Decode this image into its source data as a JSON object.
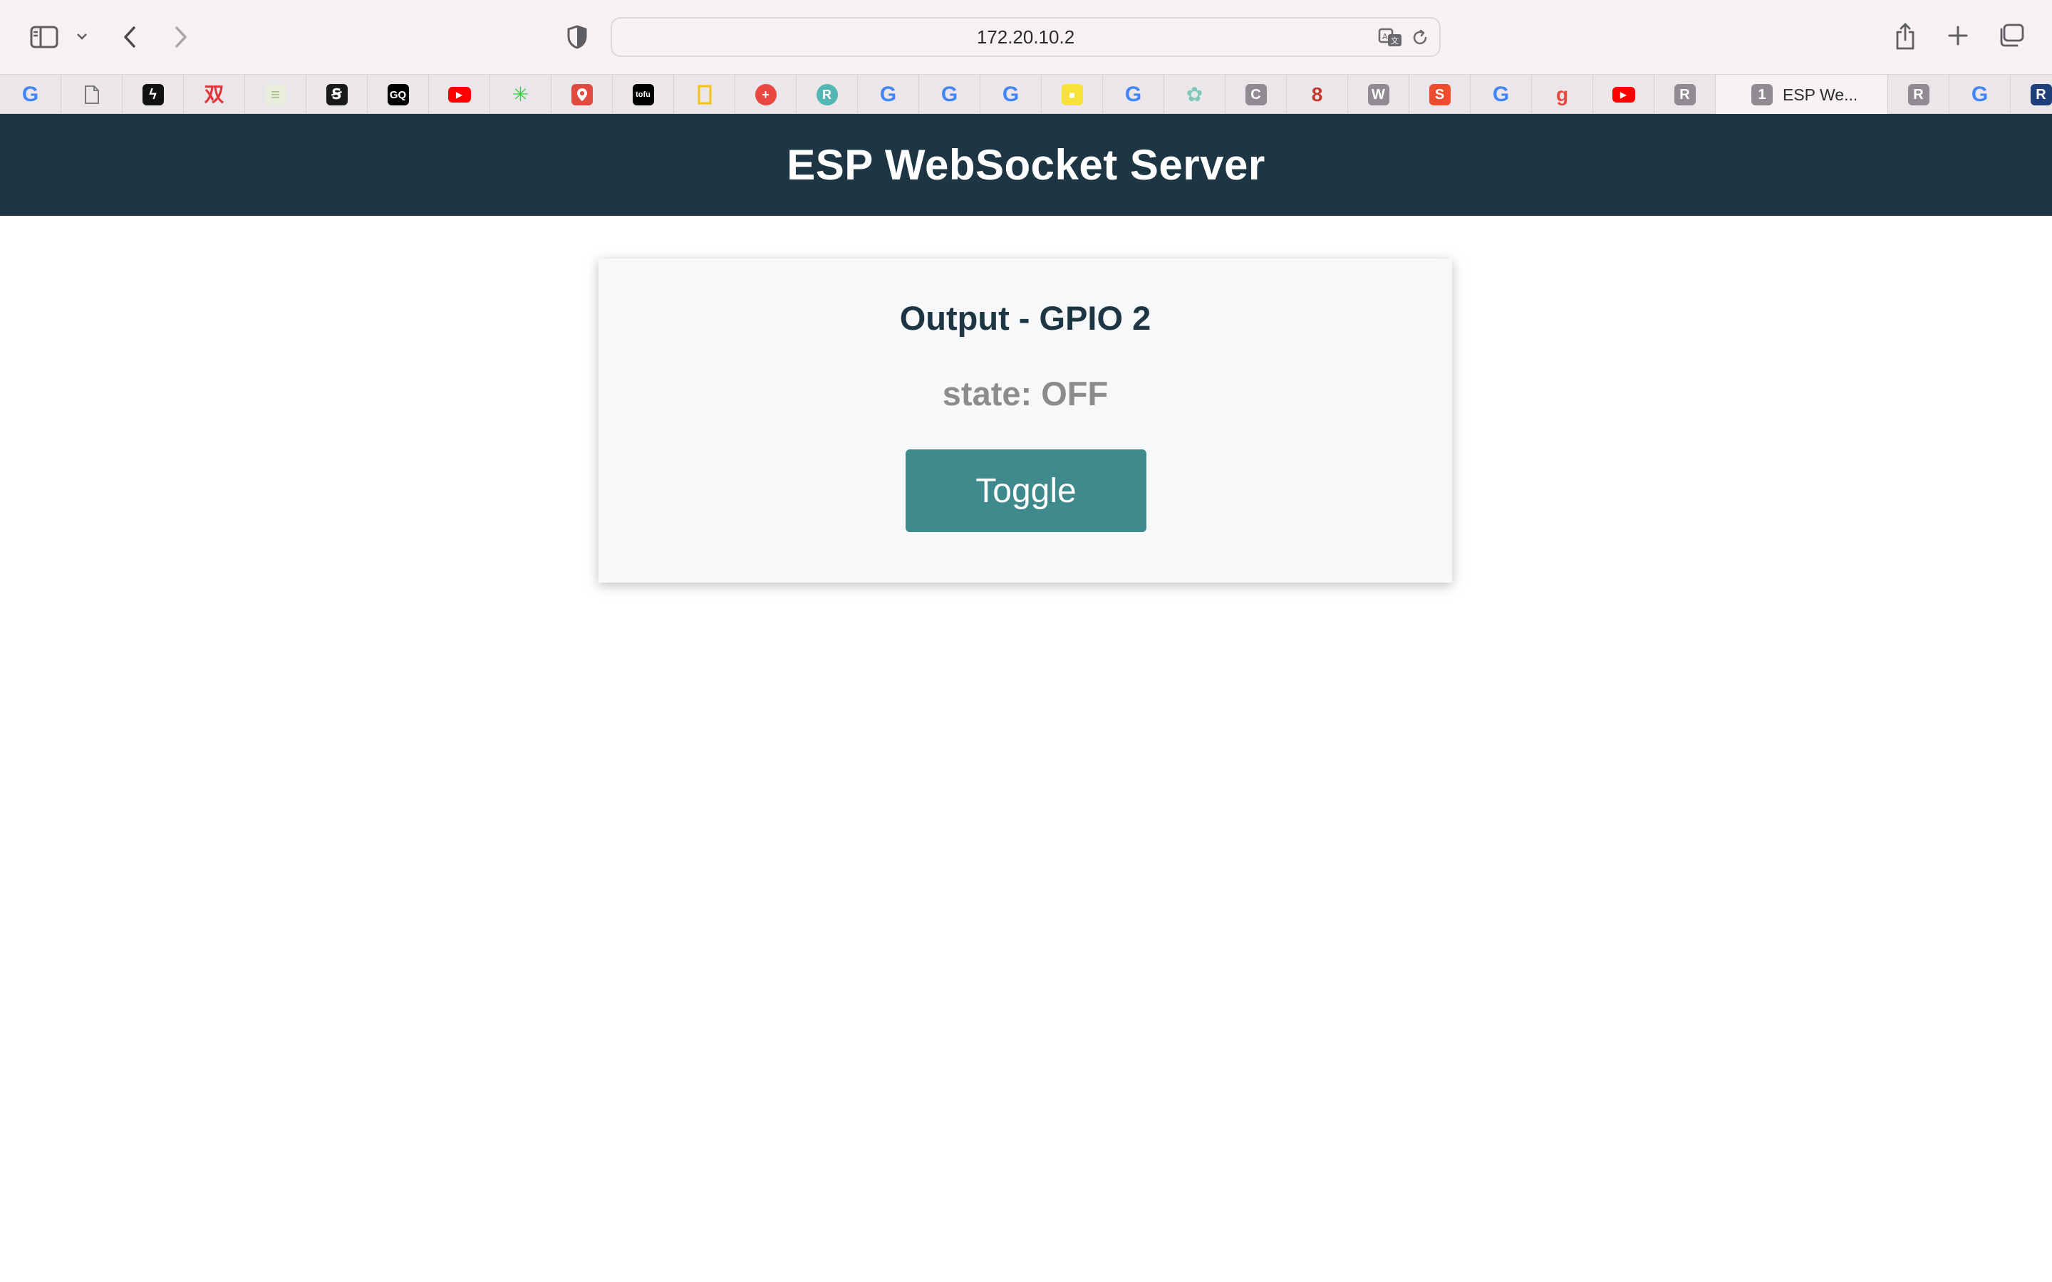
{
  "browser": {
    "url": "172.20.10.2",
    "tabs": [
      {
        "icon": "google-icon",
        "glyph": "G",
        "color": "#4285f4"
      },
      {
        "icon": "document-icon",
        "glyph": "",
        "color": "#7a7a7a"
      },
      {
        "icon": "lightning-app-icon",
        "glyph": "ϟ",
        "color": "#111111"
      },
      {
        "icon": "double-happiness-icon",
        "glyph": "双",
        "color": "#e0343a"
      },
      {
        "icon": "news-page-icon",
        "glyph": "≡",
        "color": "#a9b98f"
      },
      {
        "icon": "spiral-logo-icon",
        "glyph": "Ꞩ",
        "color": "#1a1a1a"
      },
      {
        "icon": "gq-icon",
        "glyph": "GQ",
        "color": "#000000"
      },
      {
        "icon": "youtube-icon",
        "glyph": "▶",
        "color": "#ff0000"
      },
      {
        "icon": "asterisk-icon",
        "glyph": "✳",
        "color": "#3ecf4a"
      },
      {
        "icon": "map-pin-icon",
        "glyph": "⬤",
        "color": "#e04a3f"
      },
      {
        "icon": "tofu-icon",
        "glyph": "tofu",
        "color": "#000000"
      },
      {
        "icon": "yellow-frame-icon",
        "glyph": "▯",
        "color": "#f3c21b"
      },
      {
        "icon": "plus-circle-icon",
        "glyph": "+",
        "color": "#e8483f"
      },
      {
        "icon": "teal-circle-icon",
        "glyph": "R",
        "color": "#52b6b2"
      },
      {
        "icon": "google-icon",
        "glyph": "G",
        "color": "#4285f4"
      },
      {
        "icon": "google-icon",
        "glyph": "G",
        "color": "#4285f4"
      },
      {
        "icon": "google-icon",
        "glyph": "G",
        "color": "#4285f4"
      },
      {
        "icon": "yellow-square-icon",
        "glyph": "■",
        "color": "#f6e238"
      },
      {
        "icon": "google-icon",
        "glyph": "G",
        "color": "#4285f4"
      },
      {
        "icon": "openai-icon",
        "glyph": "✿",
        "color": "#7fc8b9"
      },
      {
        "icon": "c-letter-icon",
        "glyph": "C",
        "color": "#8f8b90"
      },
      {
        "icon": "red-dot-icon",
        "glyph": "8",
        "color": "#c0392b"
      },
      {
        "icon": "w-letter-icon",
        "glyph": "W",
        "color": "#8f8b90"
      },
      {
        "icon": "shopping-bag-icon",
        "glyph": "S",
        "color": "#ee4d2d"
      },
      {
        "icon": "google-icon",
        "glyph": "G",
        "color": "#4285f4"
      },
      {
        "icon": "g-script-icon",
        "glyph": "g",
        "color": "#e8483f"
      },
      {
        "icon": "youtube-icon",
        "glyph": "▶",
        "color": "#ff0000"
      },
      {
        "icon": "r-letter-icon",
        "glyph": "R",
        "color": "#8f8b90"
      }
    ],
    "active_tab": {
      "badge": "1",
      "title": "ESP We..."
    },
    "trailing_tabs": [
      {
        "icon": "r-letter-icon",
        "glyph": "R",
        "color": "#8f8b90"
      },
      {
        "icon": "google-icon",
        "glyph": "G",
        "color": "#4285f4"
      },
      {
        "icon": "r-navy-icon",
        "glyph": "R",
        "color": "#1f3f7a"
      }
    ]
  },
  "page": {
    "header_title": "ESP WebSocket Server",
    "card_title": "Output - GPIO 2",
    "state_label": "state: ",
    "state_value": "OFF",
    "toggle_label": "Toggle"
  },
  "colors": {
    "header_bg": "#1e3644",
    "button_bg": "#3f8a8c",
    "card_bg": "#f7f8fa",
    "state_text": "#8c8c8c"
  }
}
